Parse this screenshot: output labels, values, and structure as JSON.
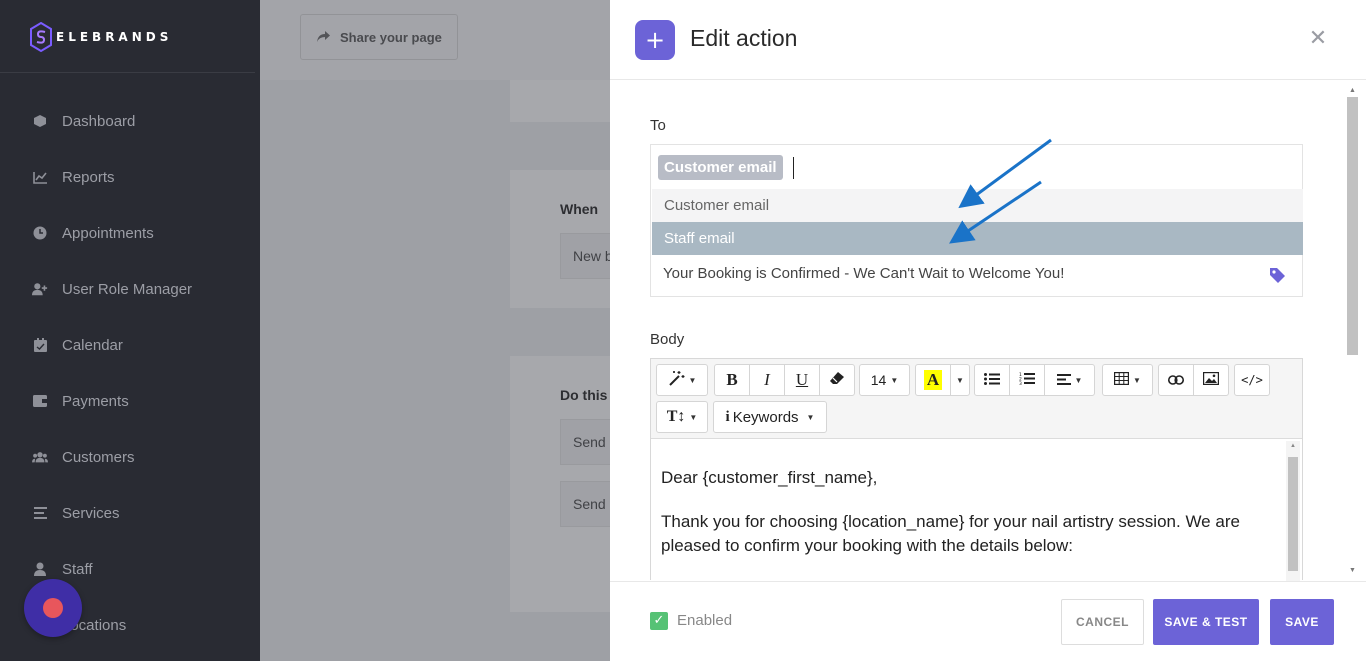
{
  "brand": {
    "name": "ELEBRANDS"
  },
  "sidebar": {
    "items": [
      {
        "label": "Dashboard",
        "icon": "dashboard-icon"
      },
      {
        "label": "Reports",
        "icon": "chart-line-icon"
      },
      {
        "label": "Appointments",
        "icon": "clock-icon"
      },
      {
        "label": "User Role Manager",
        "icon": "user-plus-icon"
      },
      {
        "label": "Calendar",
        "icon": "calendar-icon"
      },
      {
        "label": "Payments",
        "icon": "wallet-icon"
      },
      {
        "label": "Customers",
        "icon": "users-icon"
      },
      {
        "label": "Services",
        "icon": "list-icon"
      },
      {
        "label": "Staff",
        "icon": "user-icon"
      },
      {
        "label": "Locations",
        "icon": "map-pin-icon"
      }
    ]
  },
  "page": {
    "share_label": "Share your page",
    "when_label": "When",
    "when_value": "New b",
    "do_this_label": "Do this",
    "action_1": "Send",
    "action_2": "Send"
  },
  "drawer": {
    "title": "Edit action",
    "to_label": "To",
    "chip": "Customer email",
    "options": [
      "Customer email",
      "Staff email"
    ],
    "subject": "Your Booking is Confirmed - We Can't Wait to Welcome You!",
    "body_label": "Body",
    "font_size": "14",
    "keywords_label": "Keywords",
    "body_lines": [
      "Dear {customer_first_name},",
      "Thank you for choosing {location_name} for your nail artistry session. We are pleased to confirm your booking with the details below:"
    ],
    "enabled_label": "Enabled",
    "cancel_label": "CANCEL",
    "save_test_label": "SAVE & TEST",
    "save_label": "SAVE"
  },
  "colors": {
    "accent": "#6c63d7",
    "sidebar_bg": "#292b33",
    "selected_option": "#a9b8c3",
    "enabled_check": "#56c275",
    "annotation_arrow": "#1a73c8"
  }
}
